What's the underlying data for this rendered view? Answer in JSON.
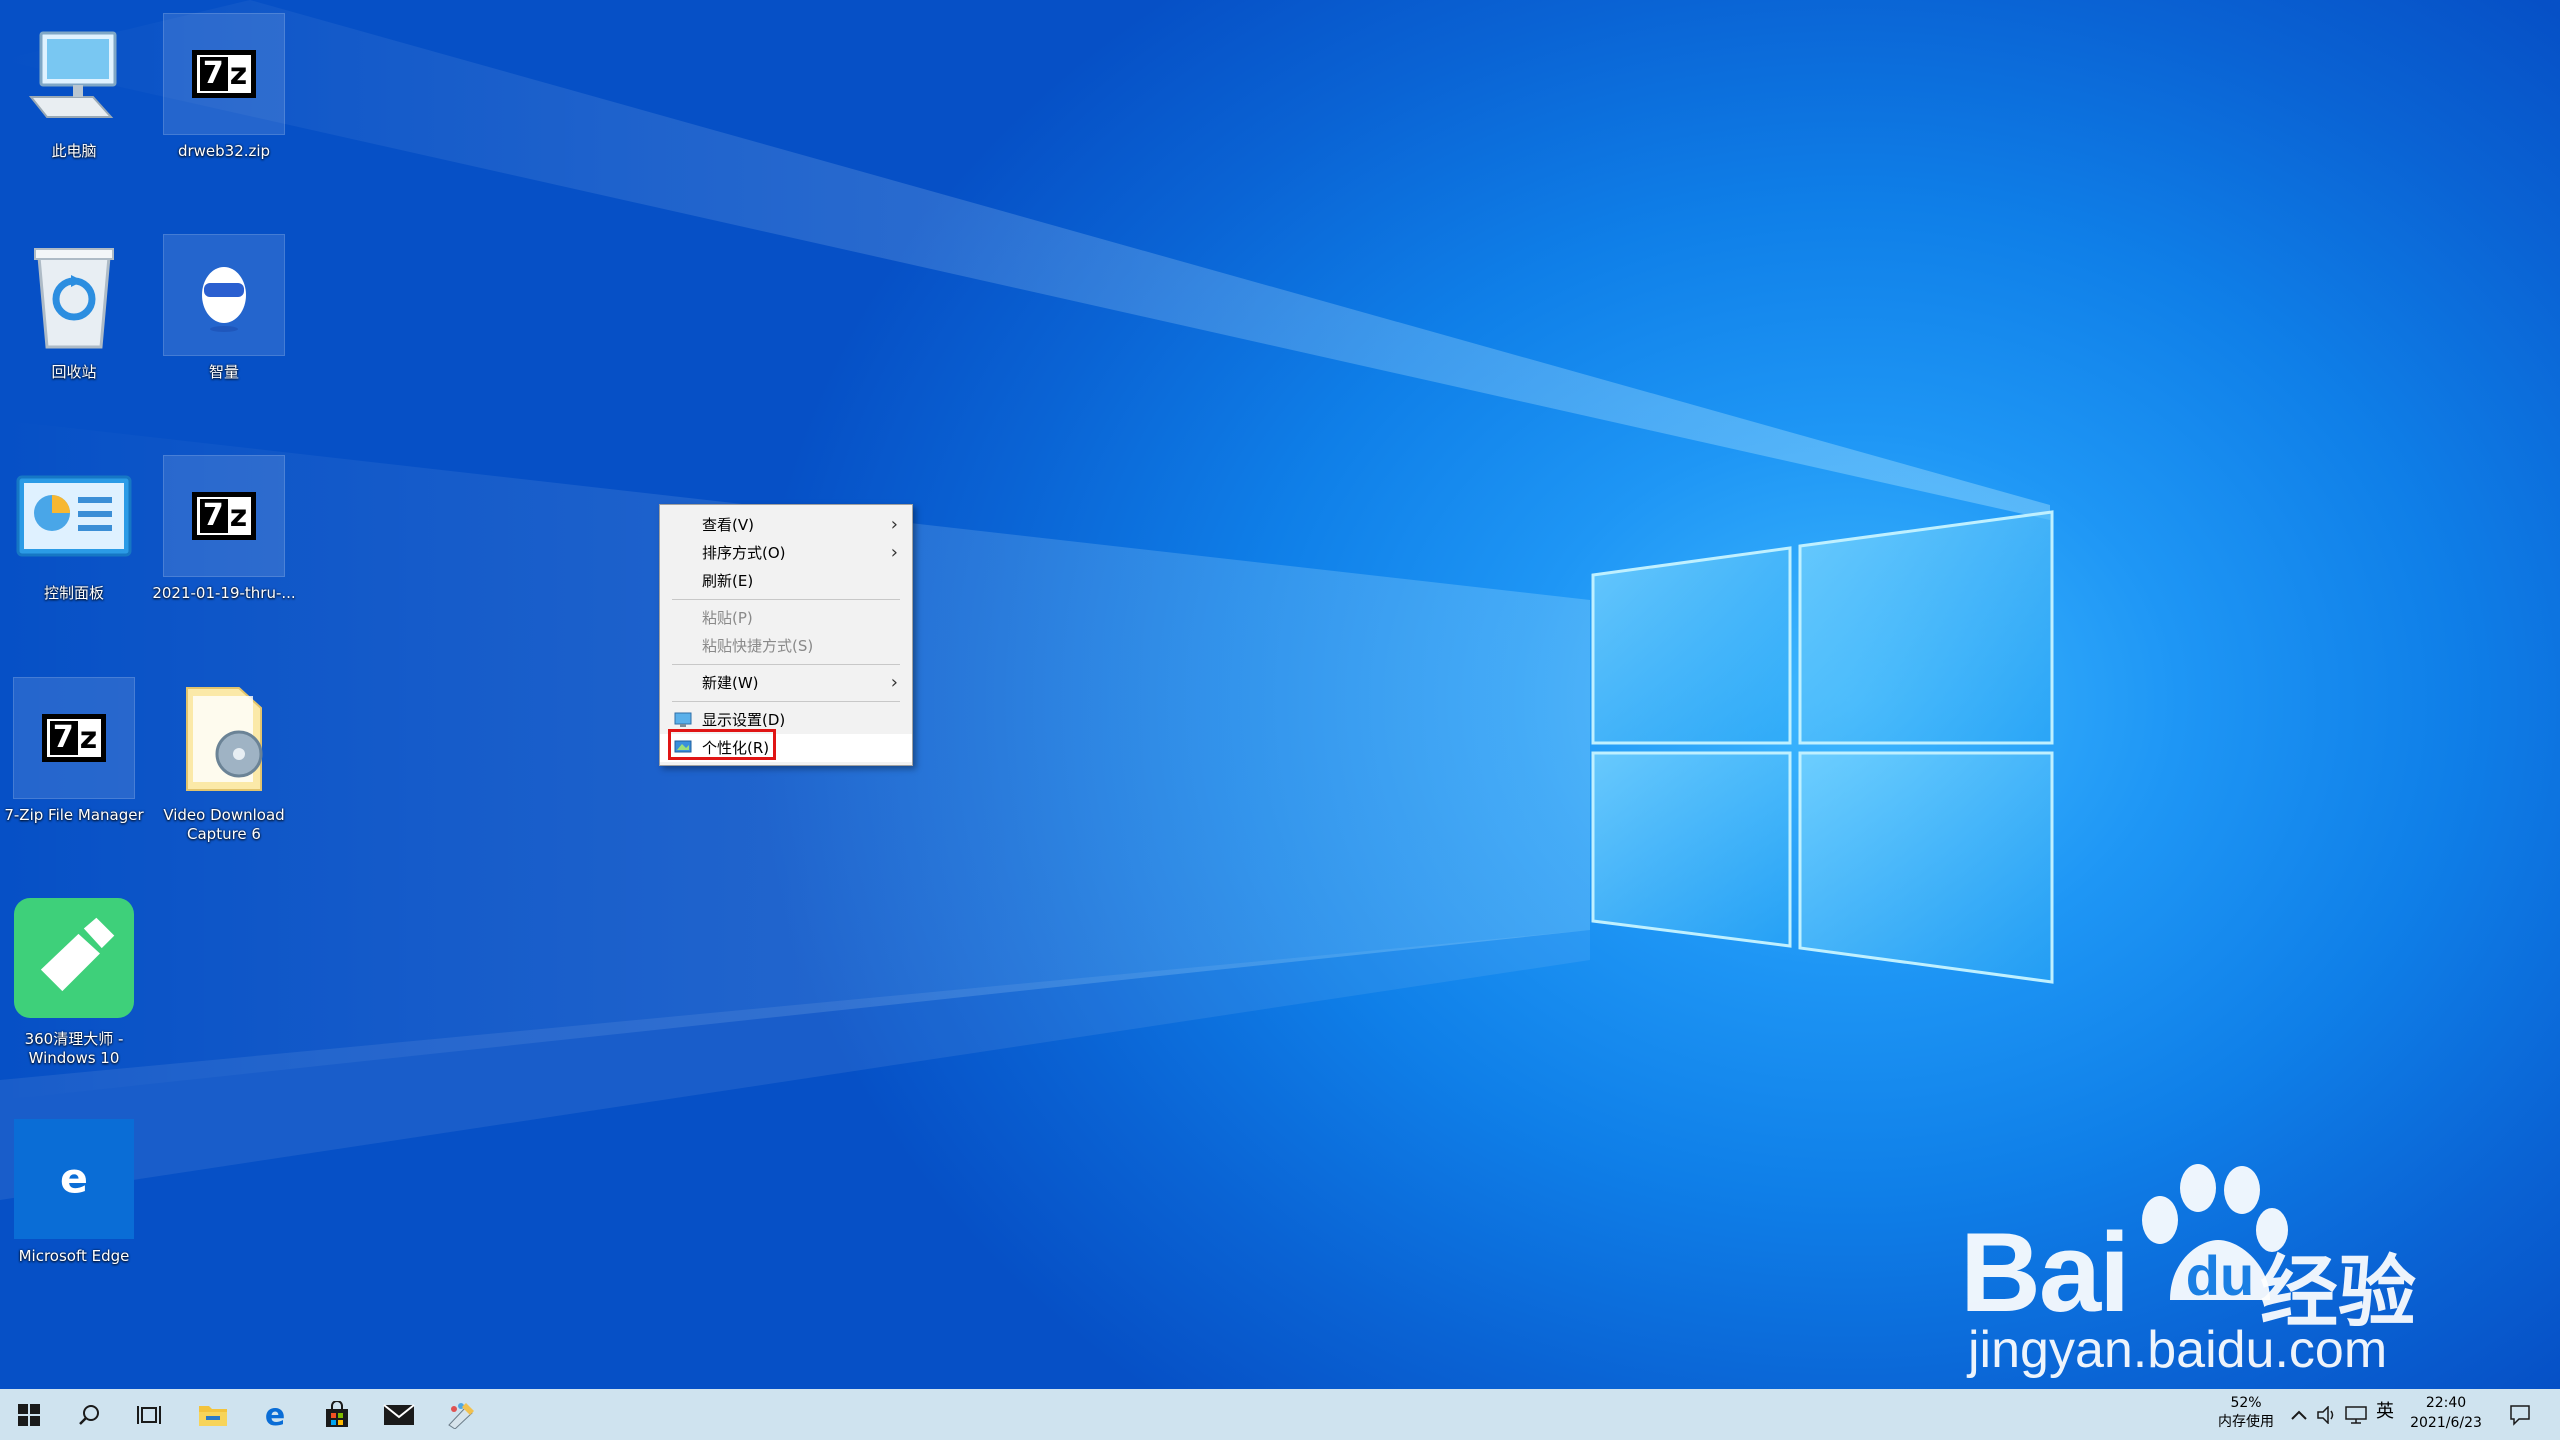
{
  "desktop": {
    "icons": [
      {
        "label": "此电脑"
      },
      {
        "label": "drweb32.zip"
      },
      {
        "label": "回收站"
      },
      {
        "label": "智量"
      },
      {
        "label": "控制面板"
      },
      {
        "label": "2021-01-19-thru-..."
      },
      {
        "label": "7-Zip File Manager"
      },
      {
        "label": "Video Download Capture 6"
      },
      {
        "label": "360清理大师 -Windows 10"
      },
      {
        "label": "Microsoft Edge"
      }
    ]
  },
  "context_menu": {
    "items": [
      {
        "label": "查看(V)",
        "submenu": true
      },
      {
        "label": "排序方式(O)",
        "submenu": true
      },
      {
        "label": "刷新(E)"
      },
      {
        "label": "粘贴(P)",
        "disabled": true
      },
      {
        "label": "粘贴快捷方式(S)",
        "disabled": true
      },
      {
        "label": "新建(W)",
        "submenu": true
      },
      {
        "label": "显示设置(D)",
        "icon": "display-settings-icon"
      },
      {
        "label": "个性化(R)",
        "icon": "personalize-icon",
        "highlighted": true
      }
    ],
    "submenu_arrow": "›",
    "highlight_color": "#e01515"
  },
  "taskbar": {
    "apps": [
      "windows-start-icon",
      "search-icon",
      "task-view-icon",
      "file-explorer-icon",
      "edge-icon",
      "store-icon",
      "mail-icon",
      "paint-icon"
    ],
    "memory": {
      "percent": "52%",
      "label": "内存使用"
    },
    "ime": "英",
    "time": "22:40",
    "date": "2021/6/23"
  },
  "watermark": {
    "brand": "Bai",
    "brand_cn": "经验",
    "url": "jingyan.baidu.com"
  },
  "colors": {
    "desktop_blue": "#0f7fe8",
    "taskbar": "#cfe3ef",
    "menu_bg": "#f2f2f2"
  }
}
